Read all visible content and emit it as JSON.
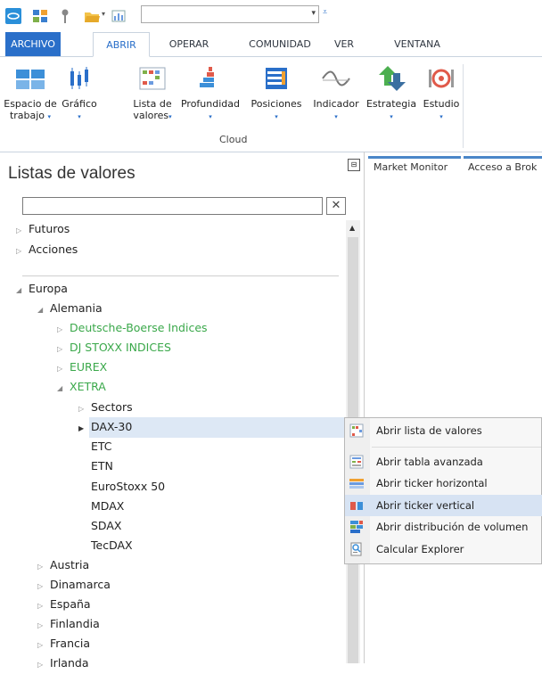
{
  "qat": {
    "combo_value": "",
    "icons": [
      "app-logo-icon",
      "layout-icon",
      "pin-icon",
      "folder-open-icon",
      "chart-small-icon"
    ]
  },
  "tabs": [
    "ARCHIVO",
    "ABRIR",
    "OPERAR",
    "COMUNIDAD",
    "VER",
    "VENTANA"
  ],
  "ribbon": {
    "buttons": [
      {
        "line1": "Espacio de",
        "line2": "trabajo",
        "caret": "▾"
      },
      {
        "line1": "Gráfico",
        "line2": "",
        "caret": "▾"
      },
      {
        "line1": "Lista de",
        "line2": "valores",
        "caret": "▾"
      },
      {
        "line1": "Profundidad",
        "line2": "",
        "caret": "▾"
      },
      {
        "line1": "Posiciones",
        "line2": "",
        "caret": "▾"
      },
      {
        "line1": "Indicador",
        "line2": "",
        "caret": "▾"
      },
      {
        "line1": "Estrategia",
        "line2": "",
        "caret": "▾"
      },
      {
        "line1": "Estudio",
        "line2": "",
        "caret": "▾"
      }
    ],
    "group_label": "Cloud"
  },
  "panel": {
    "title": "Listas de valores",
    "search_value": "",
    "close_glyph": "✕",
    "pin_glyph": "⊟",
    "tree": [
      {
        "label": "Futuros",
        "tri": "▷"
      },
      {
        "label": "Acciones",
        "tri": "▷"
      },
      {
        "label": "Europa",
        "tri": "◢"
      },
      {
        "label": "Alemania",
        "tri": "◢"
      },
      {
        "label": "Deutsche-Boerse Indices",
        "tri": "▷"
      },
      {
        "label": "DJ STOXX INDICES",
        "tri": "▷"
      },
      {
        "label": "EUREX",
        "tri": "▷"
      },
      {
        "label": "XETRA",
        "tri": "◢"
      },
      {
        "label": "Sectors",
        "tri": "▷"
      },
      {
        "label": "DAX-30",
        "tri": "▶"
      },
      {
        "label": "ETC",
        "tri": ""
      },
      {
        "label": "ETN",
        "tri": ""
      },
      {
        "label": "EuroStoxx 50",
        "tri": ""
      },
      {
        "label": "MDAX",
        "tri": ""
      },
      {
        "label": "SDAX",
        "tri": ""
      },
      {
        "label": "TecDAX",
        "tri": ""
      },
      {
        "label": "Austria",
        "tri": "▷"
      },
      {
        "label": "Dinamarca",
        "tri": "▷"
      },
      {
        "label": "España",
        "tri": "▷"
      },
      {
        "label": "Finlandia",
        "tri": "▷"
      },
      {
        "label": "Francia",
        "tri": "▷"
      },
      {
        "label": "Irlanda",
        "tri": "▷"
      }
    ]
  },
  "right_tabs": [
    "Market Monitor",
    "Acceso a Brok"
  ],
  "context_menu": [
    {
      "label": "Abrir lista de valores",
      "icon": "watchlist-icon"
    },
    {
      "label": "Abrir tabla avanzada",
      "icon": "table-icon"
    },
    {
      "label": "Abrir ticker horizontal",
      "icon": "ticker-horizontal-icon"
    },
    {
      "label": "Abrir ticker vertical",
      "icon": "ticker-vertical-icon"
    },
    {
      "label": "Abrir distribución de volumen",
      "icon": "volume-distribution-icon"
    },
    {
      "label": "Calcular Explorer",
      "icon": "explorer-icon"
    }
  ],
  "colors": {
    "accent": "#2a6fc9",
    "green_text": "#3aa84a",
    "selection": "#dde8f5",
    "menu_highlight": "#d7e3f3"
  }
}
